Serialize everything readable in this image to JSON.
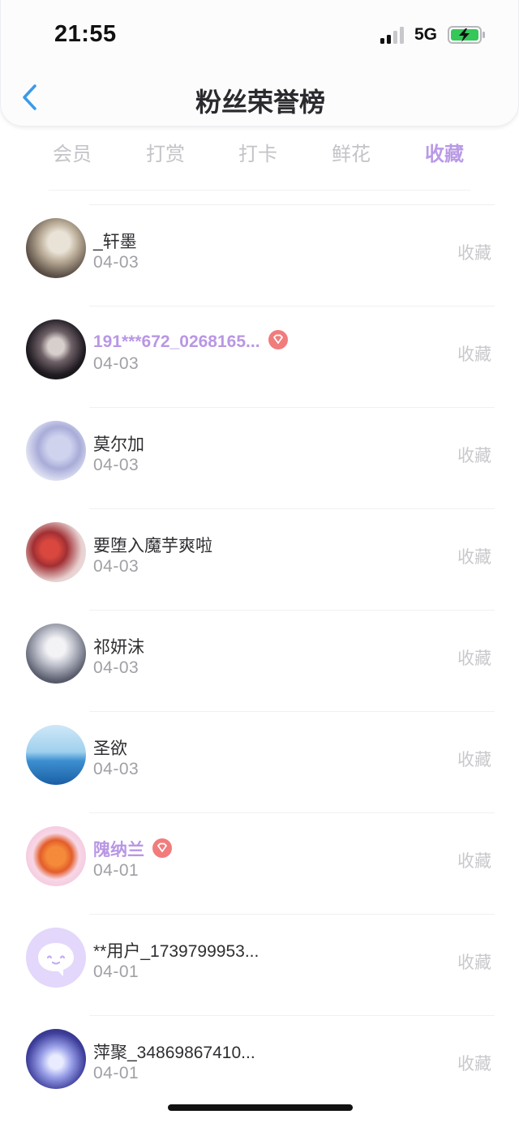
{
  "status_bar": {
    "time": "21:55",
    "network": "5G"
  },
  "nav": {
    "title": "粉丝荣誉榜",
    "back_icon": "chevron-left-icon"
  },
  "tabs": [
    {
      "label": "会员",
      "active": false
    },
    {
      "label": "打赏",
      "active": false
    },
    {
      "label": "打卡",
      "active": false
    },
    {
      "label": "鲜花",
      "active": false
    },
    {
      "label": "收藏",
      "active": true
    }
  ],
  "colors": {
    "accent": "#b99ae6",
    "vip_badge": "#f17c7c",
    "back_icon": "#3b9ae8"
  },
  "fans": [
    {
      "name": "_轩墨",
      "date": "04-03",
      "action": "收藏",
      "vip": false
    },
    {
      "name": "191***672_0268165...",
      "date": "04-03",
      "action": "收藏",
      "vip": true
    },
    {
      "name": "莫尔加",
      "date": "04-03",
      "action": "收藏",
      "vip": false
    },
    {
      "name": "要堕入魔芋爽啦",
      "date": "04-03",
      "action": "收藏",
      "vip": false
    },
    {
      "name": "祁妍沫",
      "date": "04-03",
      "action": "收藏",
      "vip": false
    },
    {
      "name": "圣欲",
      "date": "04-03",
      "action": "收藏",
      "vip": false
    },
    {
      "name": "隗纳兰",
      "date": "04-01",
      "action": "收藏",
      "vip": true
    },
    {
      "name": "**用户_1739799953...",
      "date": "04-01",
      "action": "收藏",
      "vip": false
    },
    {
      "name": "萍聚_34869867410...",
      "date": "04-01",
      "action": "收藏",
      "vip": false
    }
  ]
}
